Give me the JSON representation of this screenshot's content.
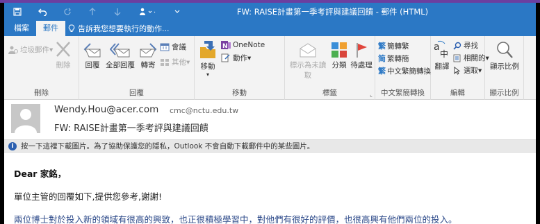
{
  "window": {
    "title": "FW: RAISE計畫第一季考評與建議回饋 - 郵件 (HTML)"
  },
  "tabs": {
    "file": "檔案",
    "message": "郵件",
    "tell_me": "告訴我您想要執行的動作..."
  },
  "ribbon": {
    "delete_group": {
      "label": "刪除",
      "junk": "垃圾郵件",
      "delete": "刪除"
    },
    "respond_group": {
      "label": "回覆",
      "reply": "回覆",
      "reply_all": "全部回覆",
      "forward": "轉寄",
      "meeting": "會議",
      "more": "其他"
    },
    "move_group": {
      "label": "移動",
      "move": "移動",
      "onenote": "OneNote",
      "actions": "動作"
    },
    "tags_group": {
      "label": "標籤",
      "mark_unread": "標示為未讀取",
      "categorize": "分類",
      "follow_up": "待處理"
    },
    "chinese_group": {
      "label": "中文繁簡轉換",
      "to_trad": "簡轉繁",
      "to_simp": "繁轉簡",
      "convert": "中文繁簡轉換"
    },
    "edit_group": {
      "label": "編輯",
      "translate": "翻譯",
      "find": "尋找",
      "related": "相關的",
      "select": "選取"
    },
    "zoom_group": {
      "label": "顯示比例",
      "zoom": "顯示比例"
    }
  },
  "message": {
    "sender": "Wendy.Hou@acer.com",
    "recipient": "cmc@nctu.edu.tw",
    "subject": "FW: RAISE計畫第一季考評與建議回饋",
    "info_bar": "按一下這裡下載圖片。為了協助保護您的隱私，Outlook 不會自動下載郵件中的某些圖片。",
    "greeting": "Dear 家銘，",
    "paragraph1": "單位主管的回覆如下,提供您參考,謝謝!",
    "paragraph2": "兩位博士對於投入新的領域有很高的興致，也正很積極學習中，對他們有很好的評價，也很高興有他們兩位的投入。"
  },
  "colors": {
    "accent": "#2b78c5",
    "top_strip": "#6b3fa0",
    "ribbon_bg": "#f3f3f3",
    "info_bar_bg": "#e8e8e8"
  }
}
